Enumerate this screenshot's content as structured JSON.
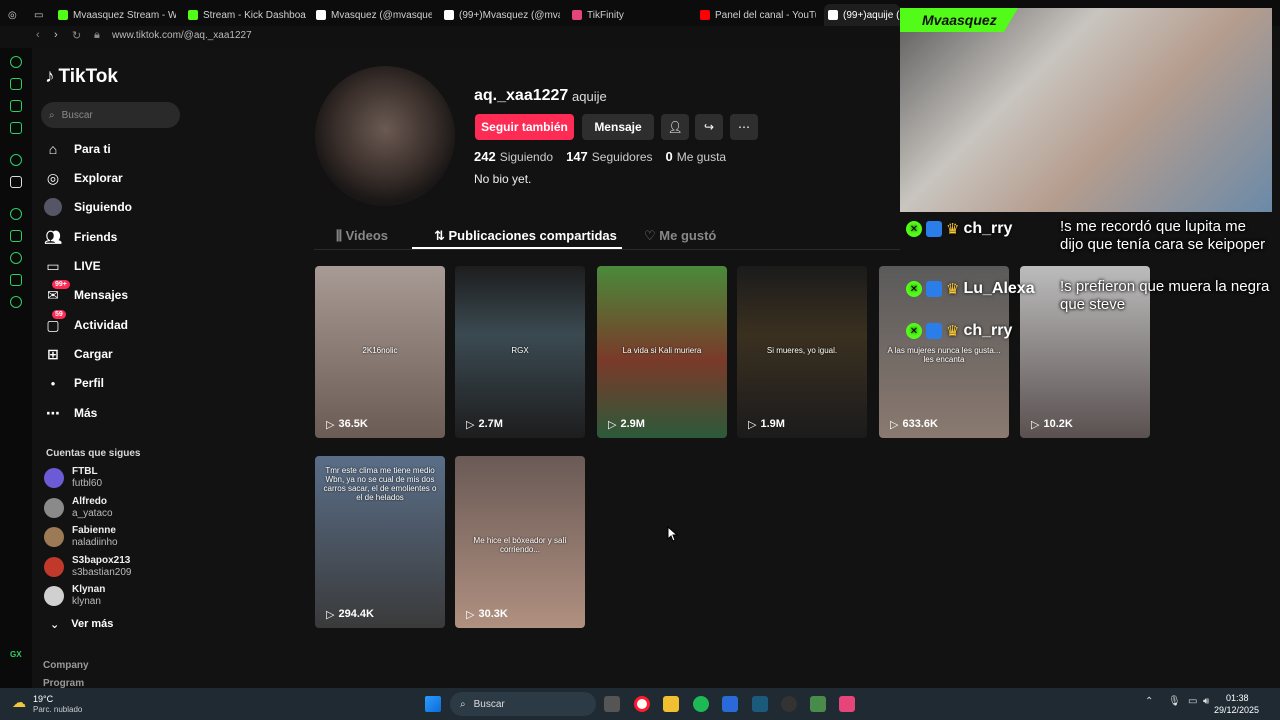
{
  "browser": {
    "tabs": [
      {
        "label": "Mvaasquez Stream - Watc",
        "color": "#53fc18"
      },
      {
        "label": "Stream - Kick Dashboard",
        "color": "#53fc18"
      },
      {
        "label": "Mvasquez (@mvasquez12",
        "color": "#ffffff"
      },
      {
        "label": "(99+)Mvasquez (@mvasq",
        "color": "#ffffff"
      },
      {
        "label": "TikFinity",
        "color": "#e6457a"
      },
      {
        "label": "Panel del canal - YouTube",
        "color": "#ff0000"
      },
      {
        "label": "(99+)aquije (@",
        "color": "#ffffff"
      }
    ],
    "url": "www.tiktok.com/@aq._xaa1227"
  },
  "sidebar": {
    "logo": "TikTok",
    "search_placeholder": "Buscar",
    "nav": [
      {
        "label": "Para ti",
        "icon": "home-icon"
      },
      {
        "label": "Explorar",
        "icon": "compass-icon"
      },
      {
        "label": "Siguiendo",
        "icon": "following-avatar-icon"
      },
      {
        "label": "Friends",
        "icon": "friends-icon"
      },
      {
        "label": "LIVE",
        "icon": "live-icon"
      },
      {
        "label": "Mensajes",
        "icon": "messages-icon",
        "badge": "99+"
      },
      {
        "label": "Actividad",
        "icon": "activity-icon",
        "badge": "59"
      },
      {
        "label": "Cargar",
        "icon": "upload-icon"
      },
      {
        "label": "Perfil",
        "icon": "profile-icon"
      },
      {
        "label": "Más",
        "icon": "more-icon"
      }
    ],
    "following_title": "Cuentas que sigues",
    "accounts": [
      {
        "name": "FTBL",
        "user": "futbl60",
        "color": "#6b5bd6"
      },
      {
        "name": "Alfredo",
        "user": "a_yataco",
        "color": "#8a8a8a"
      },
      {
        "name": "Fabienne",
        "user": "naladiinho",
        "color": "#9c7a55"
      },
      {
        "name": "S3bapox213",
        "user": "s3bastian209",
        "color": "#c0392b"
      },
      {
        "name": "Klynan",
        "user": "klynan",
        "color": "#d0d0d0"
      }
    ],
    "see_more": "Ver más",
    "footer": [
      "Company",
      "Program"
    ]
  },
  "profile": {
    "username": "aq._xaa1227",
    "nickname": "aquije",
    "follow_label": "Seguir también",
    "message_label": "Mensaje",
    "following_count": "242",
    "following_label": "Siguiendo",
    "followers_count": "147",
    "followers_label": "Seguidores",
    "likes_count": "0",
    "likes_label": "Me gusta",
    "bio": "No bio yet."
  },
  "profile_tabs": [
    {
      "label": "Videos",
      "icon": "grid-icon"
    },
    {
      "label": "Publicaciones compartidas",
      "icon": "repost-icon",
      "active": true
    },
    {
      "label": "Me gustó",
      "icon": "heart-outline-icon"
    }
  ],
  "videos": [
    {
      "views": "36.5K",
      "caption": "2K16nolic",
      "bg": "linear-gradient(180deg,#a89a94,#6b5b55)"
    },
    {
      "views": "2.7M",
      "caption": "RGX",
      "bg": "linear-gradient(180deg,#1d1d1d,#3b4a52 40%,#1d1d1d)"
    },
    {
      "views": "2.9M",
      "caption": "La vida si Kali muriera",
      "bg": "linear-gradient(180deg,#4a8a3a,#7a3a2a 55%,#2c5a3a)"
    },
    {
      "views": "1.9M",
      "caption": "Si mueres, yo igual.",
      "bg": "linear-gradient(180deg,#1b1b1b,#3a3020 40%,#1b1b1b)"
    },
    {
      "views": "633.6K",
      "caption": "A las mujeres nunca les gusta... les encanta",
      "bg": "linear-gradient(180deg,#5a5a5a,#8a7a70)"
    },
    {
      "views": "10.2K",
      "caption": "",
      "bg": "linear-gradient(180deg,#bcbcbc,#5a5050)"
    },
    {
      "views": "294.4K",
      "caption": "Tmr este clima me tiene medio Wbn, ya no se cual de mis dos carros sacar, el de emolientes o el de helados",
      "bg": "linear-gradient(180deg,#5a6e88,#3a3a3a)"
    },
    {
      "views": "30.3K",
      "caption": "Me hice el bóxeador y salí corriendo...",
      "bg": "linear-gradient(180deg,#6a5a56,#b09080)"
    }
  ],
  "stream": {
    "streamer": "Mvaasquez",
    "chat": [
      {
        "user": "ch_rry",
        "msg": "!s me recordó que lupita me dijo que tenía cara se keipoper"
      },
      {
        "user": "Lu_Alexa",
        "msg": "!s prefieron que muera la negra que steve"
      },
      {
        "user": "ch_rry",
        "msg": ""
      }
    ]
  },
  "taskbar": {
    "weather_temp": "19°C",
    "weather_desc": "Parc. nublado",
    "search": "Buscar",
    "time": "01:38",
    "date": "29/12/2025"
  }
}
